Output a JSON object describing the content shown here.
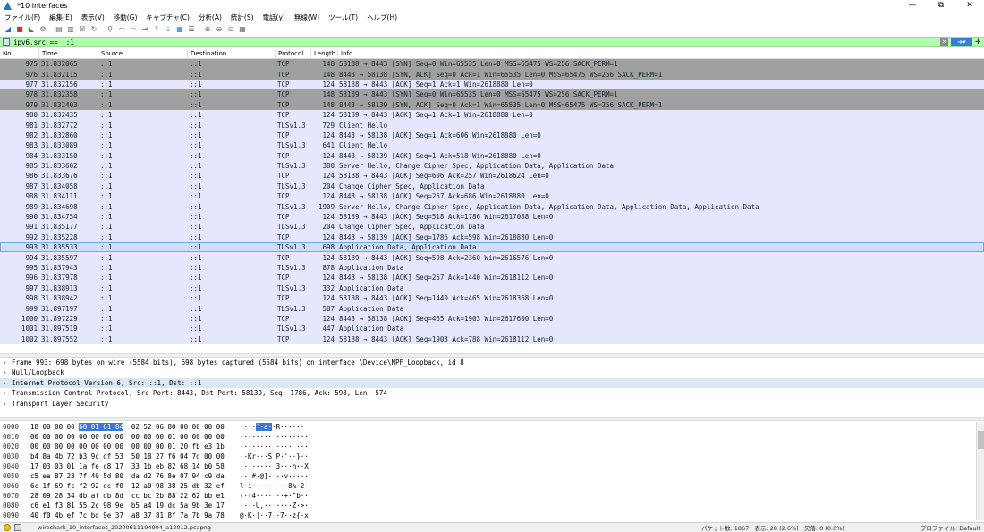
{
  "window": {
    "title": "*10 interfaces",
    "controls": [
      "—",
      "⧉",
      "✕"
    ]
  },
  "menu": [
    "ファイル(F)",
    "編集(E)",
    "表示(V)",
    "移動(G)",
    "キャプチャ(C)",
    "分析(A)",
    "統計(S)",
    "電話(y)",
    "無線(W)",
    "ツール(T)",
    "ヘルプ(H)"
  ],
  "filter": {
    "value": "ipv6.src == ::1",
    "clear_icon": "clear-icon",
    "apply_icon": "arrow-right-icon",
    "add_label": "+"
  },
  "packet_list": {
    "columns": [
      "No.",
      "Time",
      "Source",
      "Destination",
      "Protocol",
      "Length",
      "Info"
    ],
    "rows": [
      {
        "no": "975",
        "time": "31.832065",
        "src": "::1",
        "dst": "::1",
        "proto": "TCP",
        "len": "148",
        "info": "58138 → 8443 [SYN] Seq=0 Win=65535 Len=0 MSS=65475 WS=256 SACK_PERM=1",
        "kind": "syn"
      },
      {
        "no": "976",
        "time": "31.832115",
        "src": "::1",
        "dst": "::1",
        "proto": "TCP",
        "len": "148",
        "info": "8443 → 58138 [SYN, ACK] Seq=0 Ack=1 Win=65535 Len=0 MSS=65475 WS=256 SACK_PERM=1",
        "kind": "syn"
      },
      {
        "no": "977",
        "time": "31.832156",
        "src": "::1",
        "dst": "::1",
        "proto": "TCP",
        "len": "124",
        "info": "58138 → 8443 [ACK] Seq=1 Ack=1 Win=2618880 Len=0",
        "kind": "normal"
      },
      {
        "no": "978",
        "time": "31.832358",
        "src": "::1",
        "dst": "::1",
        "proto": "TCP",
        "len": "148",
        "info": "58139 → 8443 [SYN] Seq=0 Win=65535 Len=0 MSS=65475 WS=256 SACK_PERM=1",
        "kind": "syn"
      },
      {
        "no": "979",
        "time": "31.832403",
        "src": "::1",
        "dst": "::1",
        "proto": "TCP",
        "len": "148",
        "info": "8443 → 58139 [SYN, ACK] Seq=0 Ack=1 Win=65535 Len=0 MSS=65475 WS=256 SACK_PERM=1",
        "kind": "syn"
      },
      {
        "no": "980",
        "time": "31.832435",
        "src": "::1",
        "dst": "::1",
        "proto": "TCP",
        "len": "124",
        "info": "58139 → 8443 [ACK] Seq=1 Ack=1 Win=2618880 Len=0",
        "kind": "normal"
      },
      {
        "no": "981",
        "time": "31.832772",
        "src": "::1",
        "dst": "::1",
        "proto": "TLSv1.3",
        "len": "729",
        "info": "Client Hello",
        "kind": "normal"
      },
      {
        "no": "982",
        "time": "31.832860",
        "src": "::1",
        "dst": "::1",
        "proto": "TCP",
        "len": "124",
        "info": "8443 → 58138 [ACK] Seq=1 Ack=606 Win=2618880 Len=0",
        "kind": "normal"
      },
      {
        "no": "983",
        "time": "31.833089",
        "src": "::1",
        "dst": "::1",
        "proto": "TLSv1.3",
        "len": "641",
        "info": "Client Hello",
        "kind": "normal"
      },
      {
        "no": "984",
        "time": "31.833150",
        "src": "::1",
        "dst": "::1",
        "proto": "TCP",
        "len": "124",
        "info": "8443 → 58139 [ACK] Seq=1 Ack=518 Win=2618880 Len=0",
        "kind": "normal"
      },
      {
        "no": "985",
        "time": "31.833602",
        "src": "::1",
        "dst": "::1",
        "proto": "TLSv1.3",
        "len": "380",
        "info": "Server Hello, Change Cipher Spec, Application Data, Application Data",
        "kind": "normal"
      },
      {
        "no": "986",
        "time": "31.833676",
        "src": "::1",
        "dst": "::1",
        "proto": "TCP",
        "len": "124",
        "info": "58138 → 8443 [ACK] Seq=606 Ack=257 Win=2618624 Len=0",
        "kind": "normal"
      },
      {
        "no": "987",
        "time": "31.834058",
        "src": "::1",
        "dst": "::1",
        "proto": "TLSv1.3",
        "len": "204",
        "info": "Change Cipher Spec, Application Data",
        "kind": "normal"
      },
      {
        "no": "988",
        "time": "31.834111",
        "src": "::1",
        "dst": "::1",
        "proto": "TCP",
        "len": "124",
        "info": "8443 → 58138 [ACK] Seq=257 Ack=686 Win=2618880 Len=0",
        "kind": "normal"
      },
      {
        "no": "989",
        "time": "31.834698",
        "src": "::1",
        "dst": "::1",
        "proto": "TLSv1.3",
        "len": "1909",
        "info": "Server Hello, Change Cipher Spec, Application Data, Application Data, Application Data, Application Data",
        "kind": "normal"
      },
      {
        "no": "990",
        "time": "31.834754",
        "src": "::1",
        "dst": "::1",
        "proto": "TCP",
        "len": "124",
        "info": "58139 → 8443 [ACK] Seq=518 Ack=1786 Win=2617088 Len=0",
        "kind": "normal"
      },
      {
        "no": "991",
        "time": "31.835177",
        "src": "::1",
        "dst": "::1",
        "proto": "TLSv1.3",
        "len": "204",
        "info": "Change Cipher Spec, Application Data",
        "kind": "normal"
      },
      {
        "no": "992",
        "time": "31.835228",
        "src": "::1",
        "dst": "::1",
        "proto": "TCP",
        "len": "124",
        "info": "8443 → 58139 [ACK] Seq=1786 Ack=598 Win=2618880 Len=0",
        "kind": "normal"
      },
      {
        "no": "993",
        "time": "31.835533",
        "src": "::1",
        "dst": "::1",
        "proto": "TLSv1.3",
        "len": "698",
        "info": "Application Data, Application Data",
        "kind": "selected"
      },
      {
        "no": "994",
        "time": "31.835597",
        "src": "::1",
        "dst": "::1",
        "proto": "TCP",
        "len": "124",
        "info": "58139 → 8443 [ACK] Seq=598 Ack=2360 Win=2616576 Len=0",
        "kind": "normal"
      },
      {
        "no": "995",
        "time": "31.837943",
        "src": "::1",
        "dst": "::1",
        "proto": "TLSv1.3",
        "len": "878",
        "info": "Application Data",
        "kind": "normal"
      },
      {
        "no": "996",
        "time": "31.837978",
        "src": "::1",
        "dst": "::1",
        "proto": "TCP",
        "len": "124",
        "info": "8443 → 58138 [ACK] Seq=257 Ack=1440 Win=2618112 Len=0",
        "kind": "normal"
      },
      {
        "no": "997",
        "time": "31.838913",
        "src": "::1",
        "dst": "::1",
        "proto": "TLSv1.3",
        "len": "332",
        "info": "Application Data",
        "kind": "normal"
      },
      {
        "no": "998",
        "time": "31.838942",
        "src": "::1",
        "dst": "::1",
        "proto": "TCP",
        "len": "124",
        "info": "58138 → 8443 [ACK] Seq=1440 Ack=465 Win=2618368 Len=0",
        "kind": "normal"
      },
      {
        "no": "999",
        "time": "31.897197",
        "src": "::1",
        "dst": "::1",
        "proto": "TLSv1.3",
        "len": "587",
        "info": "Application Data",
        "kind": "normal"
      },
      {
        "no": "1000",
        "time": "31.897229",
        "src": "::1",
        "dst": "::1",
        "proto": "TCP",
        "len": "124",
        "info": "8443 → 58138 [ACK] Seq=465 Ack=1903 Win=2617600 Len=0",
        "kind": "normal"
      },
      {
        "no": "1001",
        "time": "31.897519",
        "src": "::1",
        "dst": "::1",
        "proto": "TLSv1.3",
        "len": "447",
        "info": "Application Data",
        "kind": "normal"
      },
      {
        "no": "1002",
        "time": "31.897552",
        "src": "::1",
        "dst": "::1",
        "proto": "TCP",
        "len": "124",
        "info": "58138 → 8443 [ACK] Seq=1903 Ack=788 Win=2618112 Len=0",
        "kind": "normal"
      }
    ]
  },
  "details": [
    "Frame 993: 698 bytes on wire (5584 bits), 698 bytes captured (5584 bits) on interface \\Device\\NPF_Loopback, id 8",
    "Null/Loopback",
    "Internet Protocol Version 6, Src: ::1, Dst: ::1",
    "Transmission Control Protocol, Src Port: 8443, Dst Port: 58139, Seq: 1786, Ack: 598, Len: 574",
    "Transport Layer Security"
  ],
  "bytes": [
    {
      "off": "0000",
      "hex_pre": "18 00 00 00 ",
      "hex_hl": "60 01 61 84",
      "hex_post": "  02 52 06 80 00 00 00 00",
      "asc_pre": "····",
      "asc_hl": "`·a·",
      "asc_post": "·R······"
    },
    {
      "off": "0010",
      "hex_pre": "00 00 00 00 00 00 00 00  00 00 00 01 00 00 00 00",
      "hex_hl": "",
      "hex_post": "",
      "asc_pre": "········ ········",
      "asc_hl": "",
      "asc_post": ""
    },
    {
      "off": "0020",
      "hex_pre": "00 00 00 00 00 00 00 00  00 00 00 01 20 fb e3 1b",
      "hex_hl": "",
      "hex_post": "",
      "asc_pre": "········ ···· ···",
      "asc_hl": "",
      "asc_post": ""
    },
    {
      "off": "0030",
      "hex_pre": "b4 8a 4b 72 b3 9c df 53  50 18 27 f6 04 7d 00 00",
      "hex_hl": "",
      "hex_post": "",
      "asc_pre": "··Kr···S P·'··}··",
      "asc_hl": "",
      "asc_post": ""
    },
    {
      "off": "0040",
      "hex_pre": "17 03 03 01 1a fe c8 17  33 1b eb 82 68 14 b0 58",
      "hex_hl": "",
      "hex_post": "",
      "asc_pre": "········ 3···h··X",
      "asc_hl": "",
      "asc_post": ""
    },
    {
      "off": "0050",
      "hex_pre": "c5 ea 87 23 7f 40 5d 80  da d2 76 8e 07 94 c9 da",
      "hex_hl": "",
      "hex_post": "",
      "asc_pre": "···#·@]· ··v·····",
      "asc_hl": "",
      "asc_post": ""
    },
    {
      "off": "0060",
      "hex_pre": "6c 1f 69 fc f2 92 dc f0  12 a0 98 38 25 db 32 ef",
      "hex_hl": "",
      "hex_post": "",
      "asc_pre": "l·i····· ···8%·2·",
      "asc_hl": "",
      "asc_post": ""
    },
    {
      "off": "0070",
      "hex_pre": "28 09 28 34 db af db 8d  cc bc 2b 88 22 62 bb e1",
      "hex_hl": "",
      "hex_post": "",
      "asc_pre": "(·(4···· ··+·\"b··",
      "asc_hl": "",
      "asc_post": ""
    },
    {
      "off": "0080",
      "hex_pre": "c6 e1 f3 81 55 2c 98 9e  b5 a4 19 dc 5a 9b 3e 17",
      "hex_hl": "",
      "hex_post": "",
      "asc_pre": "····U,·· ····Z·>·",
      "asc_hl": "",
      "asc_post": ""
    },
    {
      "off": "0090",
      "hex_pre": "40 f0 4b ef 7c bd 9e 37  a8 37 81 8f 7a 7b 9a 78",
      "hex_hl": "",
      "hex_post": "",
      "asc_pre": "@·K·|··7 ·7··z{·x",
      "asc_hl": "",
      "asc_post": ""
    }
  ],
  "status": {
    "file": "wireshark_10_interfaces_20200611194904_a12012.pcapng",
    "packets": "パケット数: 1867 · 表示: 28 (2.6%) · 欠落: 0 (0.0%)",
    "profile": "プロファイル: Default"
  },
  "colors": {
    "tcp_row": "#e7e6ff",
    "syn_row": "#a0a0a0",
    "filter_bg": "#afffaf",
    "selected_row": "#cce0f7"
  }
}
